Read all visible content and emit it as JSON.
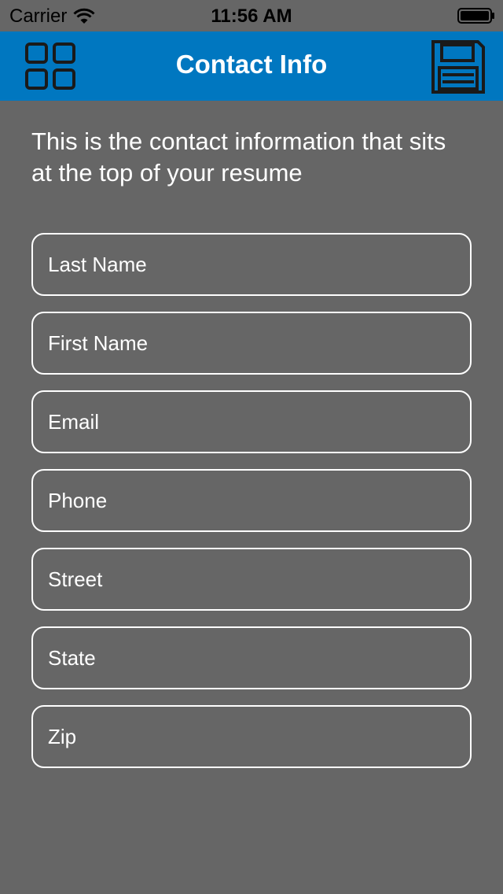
{
  "status_bar": {
    "carrier": "Carrier",
    "time": "11:56 AM"
  },
  "nav": {
    "title": "Contact Info",
    "left_icon": "grid-icon",
    "right_icon": "save-icon",
    "color": "#0077c0"
  },
  "intro_text": "This is the contact information that sits at the top of your resume",
  "form": {
    "last_name": {
      "placeholder": "Last Name",
      "value": ""
    },
    "first_name": {
      "placeholder": "First Name",
      "value": ""
    },
    "email": {
      "placeholder": "Email",
      "value": ""
    },
    "phone": {
      "placeholder": "Phone",
      "value": ""
    },
    "street": {
      "placeholder": "Street",
      "value": ""
    },
    "state": {
      "placeholder": "State",
      "value": ""
    },
    "zip": {
      "placeholder": "Zip",
      "value": ""
    }
  },
  "colors": {
    "background": "#666666",
    "accent": "#0077c0",
    "text": "#ffffff"
  }
}
